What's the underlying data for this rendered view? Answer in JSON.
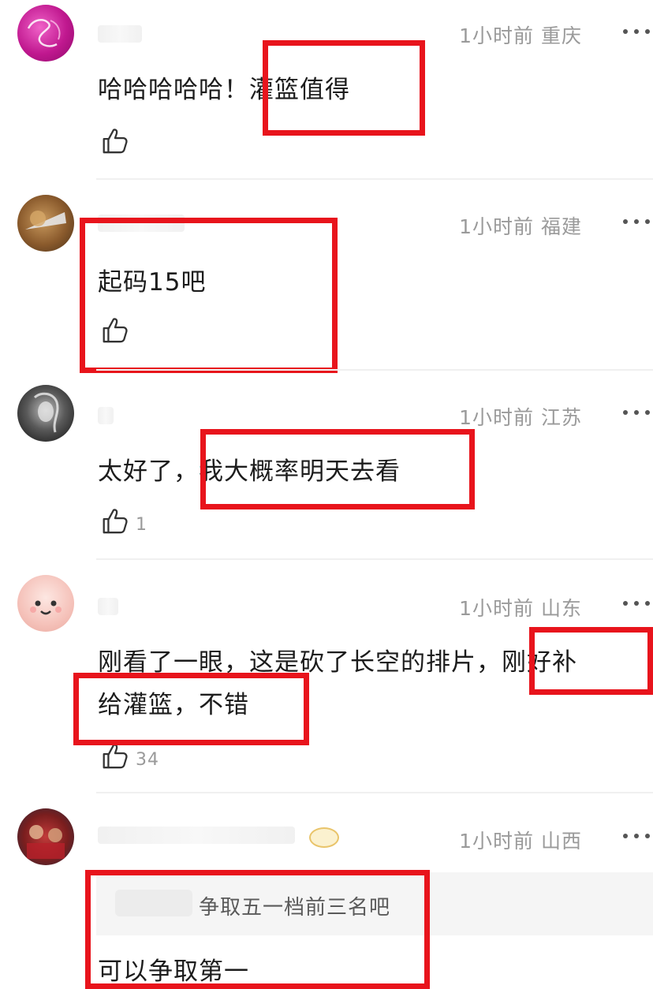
{
  "comments": [
    {
      "time": "1小时前",
      "location": "重庆",
      "text": "哈哈哈哈哈！灌篮值得",
      "likes": ""
    },
    {
      "time": "1小时前",
      "location": "福建",
      "text": "起码15吧",
      "likes": ""
    },
    {
      "time": "1小时前",
      "location": "江苏",
      "text": "太好了，我大概率明天去看",
      "likes": "1"
    },
    {
      "time": "1小时前",
      "location": "山东",
      "text_line1": "刚看了一眼，这是砍了长空的排片，刚好补",
      "text_line2": "给灌篮，不错",
      "likes": "34"
    },
    {
      "time": "1小时前",
      "location": "山西",
      "quote": "争取五一档前三名吧",
      "text": "可以争取第一"
    }
  ],
  "colors": {
    "highlight_box": "#e8141c",
    "meta_text": "#9a9a9a"
  },
  "icons": [
    "thumbs-up-icon",
    "more-options-icon",
    "avatar"
  ]
}
